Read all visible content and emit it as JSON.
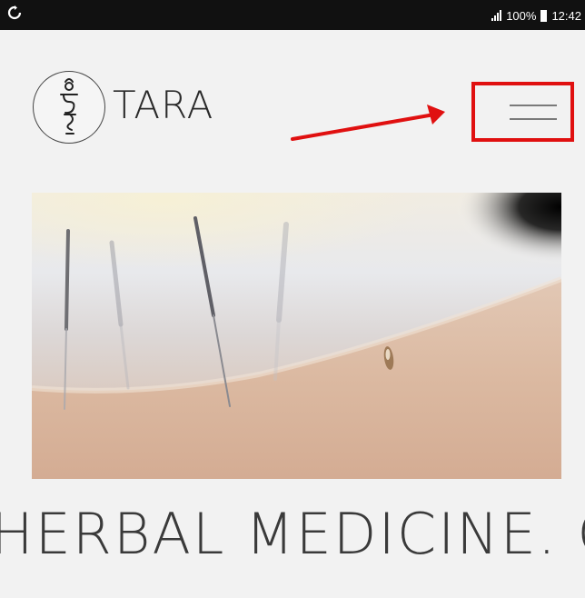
{
  "status_bar": {
    "left_icon": "sync-icon",
    "battery_percent": "100%",
    "time": "12:42"
  },
  "header": {
    "brand_name": "TARA",
    "logo_icon": "tibetan-syllable-logo-icon",
    "menu_icon": "hamburger-menu-icon"
  },
  "annotation": {
    "color": "#e01010",
    "arrow_icon": "red-arrow-icon"
  },
  "hero": {
    "image_subject": "acupuncture-needles-photo"
  },
  "ticker": {
    "text": "HERBAL MEDICINE. CUPPING"
  }
}
